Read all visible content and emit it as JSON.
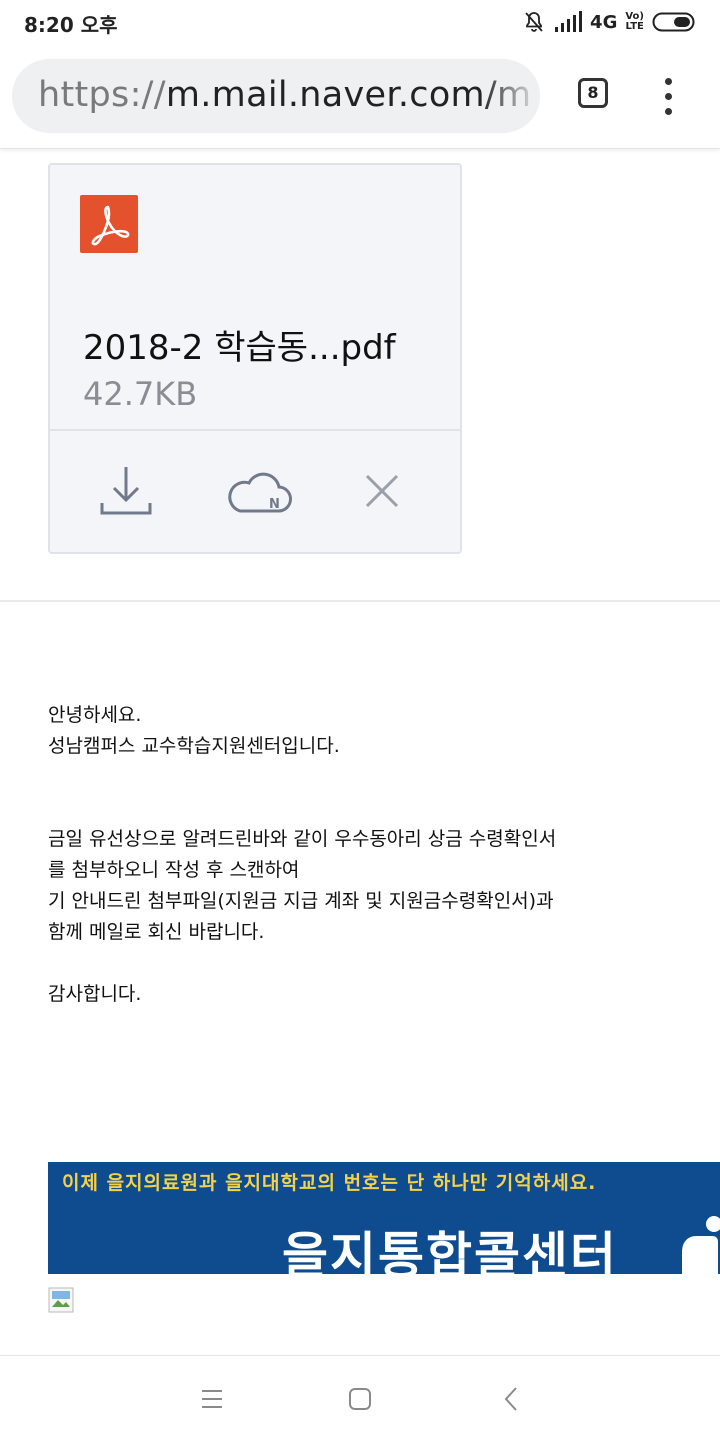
{
  "status_bar": {
    "time": "8:20 오후",
    "network": "4G",
    "volte": "Vo) LTE",
    "icons": [
      "mute-icon",
      "signal-icon",
      "battery-icon"
    ]
  },
  "browser": {
    "url_scheme": "https://",
    "url_host": "m.mail.naver.com/m",
    "tab_count": "8",
    "menu_icon": "more-vert-icon"
  },
  "attachment": {
    "file_name": "2018-2 학습동...pdf",
    "file_size": "42.7KB",
    "file_icon": "pdf-icon",
    "actions": [
      "download-icon",
      "naver-cloud-icon",
      "close-icon"
    ],
    "accent_color": "#e4512d"
  },
  "email": {
    "greeting": "안녕하세요.",
    "intro": "성남캠퍼스 교수학습지원센터입니다.",
    "body_lines": [
      "금일 유선상으로 알려드린바와 같이 우수동아리 상금 수령확인서",
      "를 첨부하오니 작성 후 스캔하여",
      "기 안내드린 첨부파일(지원금 지급 계좌 및 지원금수령확인서)과",
      "함께 메일로 회신 바랍니다."
    ],
    "closing": "감사합니다."
  },
  "banner": {
    "top_text": "이제 을지의료원과 을지대학교의 번호는  단 하나만 기억하세요.",
    "main_text": "을지통합콜센터",
    "background_color": "#0f4c8f",
    "top_text_color": "#f5d24a"
  },
  "nav": {
    "buttons": [
      "menu-icon",
      "home-icon",
      "back-icon"
    ]
  }
}
